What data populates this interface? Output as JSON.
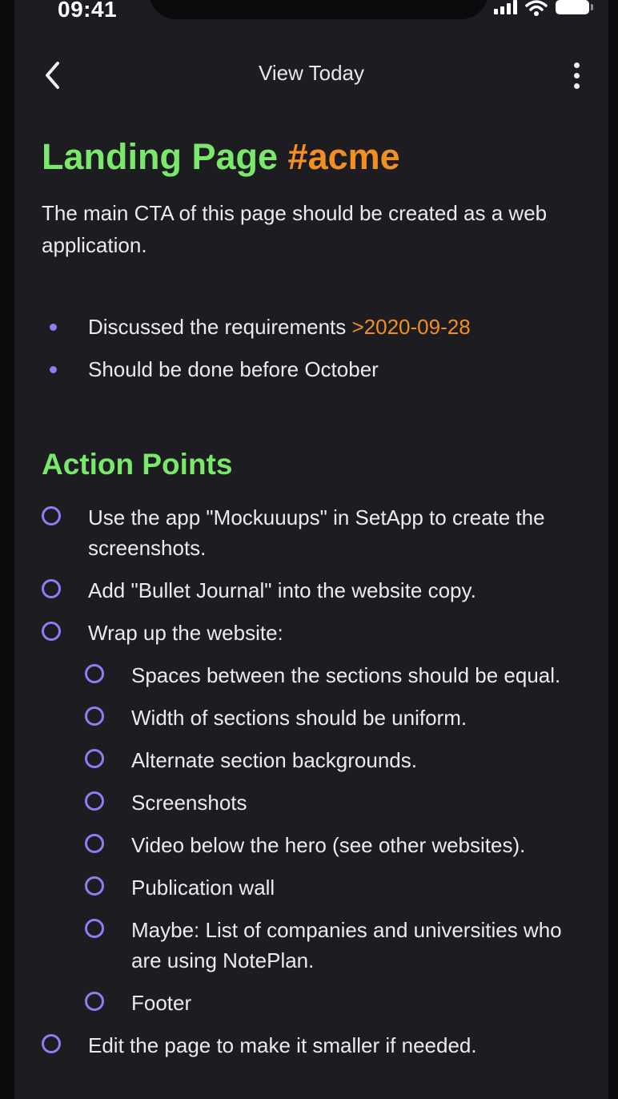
{
  "status_bar": {
    "time": "09:41"
  },
  "nav": {
    "title": "View Today"
  },
  "note": {
    "title": "Landing Page",
    "tag": "#acme",
    "intro": "The main CTA of this page should be created as a web application.",
    "bullets": [
      {
        "text": "Discussed the requirements ",
        "date": ">2020-09-28"
      },
      {
        "text": "Should be done before October",
        "date": ""
      }
    ],
    "section_heading": "Action Points",
    "tasks": [
      {
        "text": "Use the app \"Mockuuups\" in SetApp to create the screenshots.",
        "level": 1
      },
      {
        "text": "Add \"Bullet Journal\" into the website copy.",
        "level": 1
      },
      {
        "text": "Wrap up the website:",
        "level": 1
      },
      {
        "text": "Spaces between the sections should be equal.",
        "level": 2
      },
      {
        "text": "Width of sections should be uniform.",
        "level": 2
      },
      {
        "text": "Alternate section backgrounds.",
        "level": 2
      },
      {
        "text": "Screenshots",
        "level": 2
      },
      {
        "text": "Video below the hero (see other websites).",
        "level": 2
      },
      {
        "text": "Publication wall",
        "level": 2
      },
      {
        "text": "Maybe: List of companies and universities who are using NotePlan.",
        "level": 2
      },
      {
        "text": "Footer",
        "level": 2
      },
      {
        "text": "Edit the page to make it smaller if needed.",
        "level": 1
      }
    ]
  },
  "colors": {
    "background": "#1d1c21",
    "heading_green": "#79e86b",
    "tag_orange": "#f18f22",
    "checkbox_purple": "#8b7ff2",
    "text": "#ebeaf0"
  },
  "icons": {
    "back": "chevron-left-icon",
    "more": "more-vertical-icon",
    "signal": "cellular-signal-icon",
    "wifi": "wifi-icon",
    "battery": "battery-icon"
  }
}
